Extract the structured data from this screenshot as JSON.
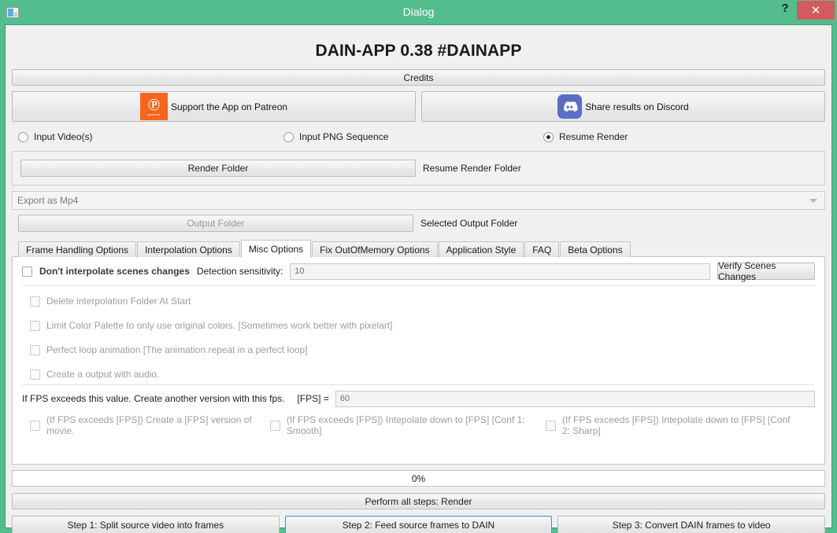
{
  "window": {
    "title": "Dialog",
    "icon": "window-icon",
    "help_label": "?",
    "close_label": "✕",
    "accent_green": "#54bd8e",
    "close_red": "#d45b5b"
  },
  "header": {
    "app_title": "DAIN-APP 0.38 #DAINAPP",
    "credits_label": "Credits"
  },
  "links": {
    "patreon": {
      "label": "Support the App on Patreon",
      "icon": "patreon-icon",
      "glyph": "℗",
      "word": "patreon",
      "color": "#f4661e"
    },
    "discord": {
      "label": "Share results on Discord",
      "icon": "discord-icon",
      "color": "#5b6ec4"
    }
  },
  "input_mode": {
    "options": [
      {
        "label": "Input Video(s)",
        "checked": false
      },
      {
        "label": "Input PNG Sequence",
        "checked": false
      },
      {
        "label": "Resume Render",
        "checked": true
      }
    ]
  },
  "folders": {
    "render_button": "Render Folder",
    "render_label": "Resume Render Folder",
    "export_combo_value": "Export as Mp4",
    "output_button": "Output Folder",
    "output_label": "Selected Output Folder"
  },
  "tabs": [
    {
      "label": "Frame Handling Options",
      "active": false
    },
    {
      "label": "Interpolation Options",
      "active": false
    },
    {
      "label": "Misc Options",
      "active": true
    },
    {
      "label": "Fix OutOfMemory Options",
      "active": false
    },
    {
      "label": "Application Style",
      "active": false
    },
    {
      "label": "FAQ",
      "active": false
    },
    {
      "label": "Beta Options",
      "active": false
    }
  ],
  "misc": {
    "scene_checkbox_label": "Don't interpolate scenes changes",
    "sensitivity_label": "Detection sensitivity:",
    "sensitivity_value": "10",
    "verify_button": "Verify Scenes Changes",
    "options": [
      {
        "label": "Delete interpolation Folder At Start",
        "checked": false,
        "disabled": true
      },
      {
        "label": "Limit Color Palette to only use original colors. [Sometimes work better with pixelart]",
        "checked": false,
        "disabled": true
      },
      {
        "label": "Perfect loop animation [The animation repeat in a perfect loop]",
        "checked": false,
        "disabled": true
      },
      {
        "label": "Create a output with audio.",
        "checked": false,
        "disabled": true
      }
    ],
    "fps_text": "If FPS exceeds this value. Create another version with this fps.",
    "fps_eq_label": "[FPS] =",
    "fps_value": "60",
    "fps_options": [
      {
        "label": "(If FPS exceeds [FPS]) Create a [FPS] version of movie.",
        "checked": false,
        "disabled": true
      },
      {
        "label": "(If FPS exceeds [FPS]) Intepolate down to  [FPS] [Conf 1: Smooth]",
        "checked": false,
        "disabled": true
      },
      {
        "label": "(If FPS exceeds [FPS]) Intepolate down to  [FPS] [Conf 2: Sharp]",
        "checked": false,
        "disabled": true
      }
    ]
  },
  "footer": {
    "progress_label": "0%",
    "progress_percent": 0,
    "render_all_label": "Perform all steps: Render",
    "steps": [
      {
        "label": "Step 1: Split source video into frames",
        "focused": false
      },
      {
        "label": "Step 2: Feed source frames to DAIN",
        "focused": true
      },
      {
        "label": "Step 3: Convert DAIN frames to video",
        "focused": false
      }
    ]
  }
}
